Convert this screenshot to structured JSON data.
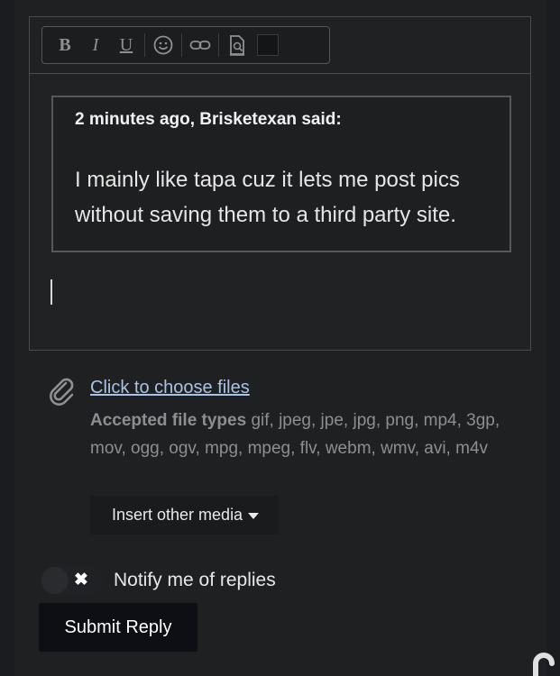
{
  "toolbar": {
    "bold_label": "B",
    "italic_label": "I",
    "underline_label": "U",
    "icons": [
      "bold-icon",
      "italic-icon",
      "underline-icon",
      "emoji-icon",
      "link-icon",
      "preview-icon",
      "color-swatch"
    ]
  },
  "quote": {
    "citation": "2 minutes ago, Brisketexan said:",
    "body": "I mainly like tapa cuz it lets me post pics without saving them to a third party site."
  },
  "attachments": {
    "choose_link": "Click to choose files",
    "accepted_label": "Accepted file types",
    "accepted_types": " gif, jpeg, jpe, jpg, png, mp4, 3gp, mov, ogg, ogv, mpg, mpeg, flv, webm, wmv, avi, m4v",
    "insert_media_label": "Insert other media"
  },
  "notify": {
    "label": "Notify me of replies",
    "toggle_symbol": "✖",
    "enabled": false
  },
  "submit": {
    "label": "Submit Reply"
  },
  "colors": {
    "background": "#1f2022",
    "link": "#a9c3e8",
    "muted_text": "#8c8e93",
    "submit_bg": "#0d0f14"
  }
}
